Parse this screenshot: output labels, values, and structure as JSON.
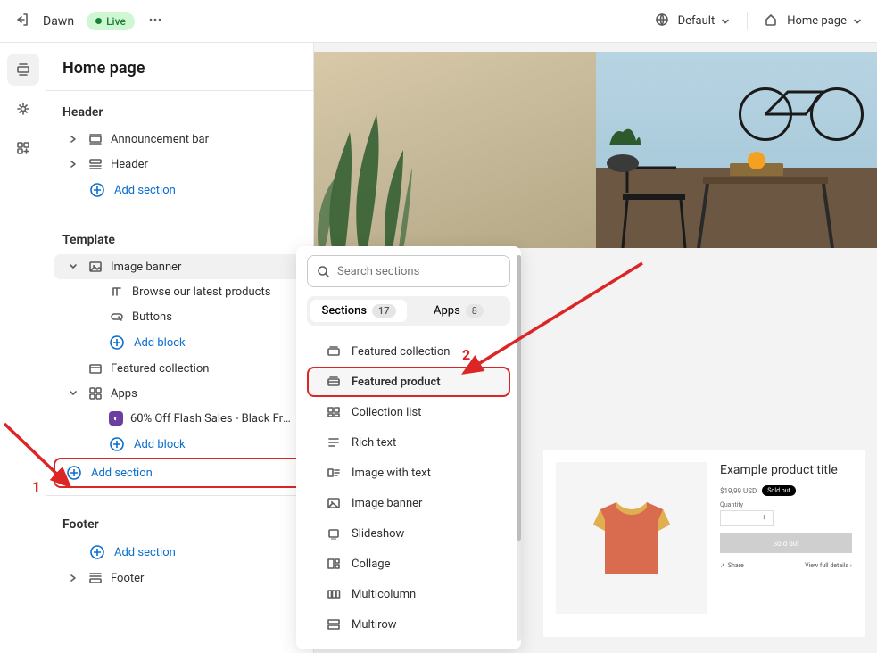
{
  "topbar": {
    "theme_name": "Dawn",
    "live_label": "Live",
    "default_label": "Default",
    "homepage_label": "Home page"
  },
  "sidebar": {
    "title": "Home page",
    "header_group": "Header",
    "header_items": {
      "ann": "Announcement bar",
      "hdr": "Header",
      "add": "Add section"
    },
    "template_group": "Template",
    "template": {
      "banner": "Image banner",
      "browse": "Browse our latest products",
      "buttons": "Buttons",
      "add_block": "Add block",
      "featured": "Featured collection",
      "apps": "Apps",
      "flash": "60% Off Flash Sales - Black Frid...",
      "add_block2": "Add block",
      "add_section": "Add section"
    },
    "footer_group": "Footer",
    "footer_add": "Add section",
    "footer_item": "Footer"
  },
  "popup": {
    "search_placeholder": "Search sections",
    "tab_sections": "Sections",
    "sections_count": "17",
    "tab_apps": "Apps",
    "apps_count": "8",
    "items": {
      "featured_collection": "Featured collection",
      "featured_product": "Featured product",
      "collection_list": "Collection list",
      "rich_text": "Rich text",
      "image_with_text": "Image with text",
      "image_banner": "Image banner",
      "slideshow": "Slideshow",
      "collage": "Collage",
      "multicolumn": "Multicolumn",
      "multirow": "Multirow"
    }
  },
  "product": {
    "title": "Example product title",
    "price": "$19,99 USD",
    "sold_pill": "Sold out",
    "qty_label": "Quantity",
    "sold_btn": "Sold out",
    "share": "Share",
    "details": "View full details",
    "chev": "›"
  },
  "callouts": {
    "one": "1",
    "two": "2"
  }
}
